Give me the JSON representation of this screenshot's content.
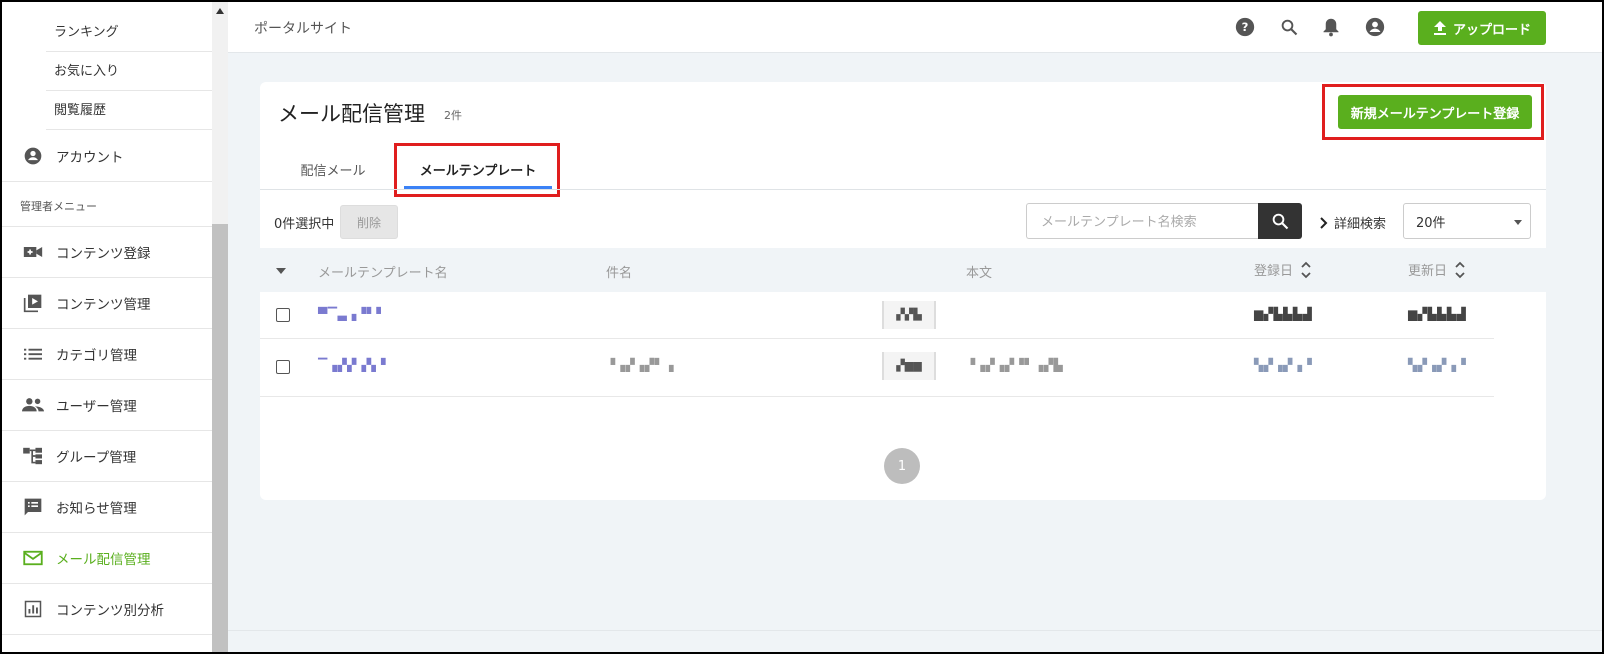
{
  "sidebar": {
    "sub_items": [
      "ランキング",
      "お気に入り",
      "閲覧履歴"
    ],
    "account_label": "アカウント",
    "admin_section_label": "管理者メニュー",
    "admin_items": [
      {
        "label": "コンテンツ登録",
        "icon": "video-add-icon"
      },
      {
        "label": "コンテンツ管理",
        "icon": "play-library-icon"
      },
      {
        "label": "カテゴリ管理",
        "icon": "list-icon"
      },
      {
        "label": "ユーザー管理",
        "icon": "people-icon"
      },
      {
        "label": "グループ管理",
        "icon": "tree-icon"
      },
      {
        "label": "お知らせ管理",
        "icon": "announcement-icon"
      },
      {
        "label": "メール配信管理",
        "icon": "mail-icon",
        "active": true
      },
      {
        "label": "コンテンツ別分析",
        "icon": "analytics-icon"
      }
    ]
  },
  "header": {
    "site_title": "ポータルサイト",
    "icons": [
      "help-icon",
      "search-icon",
      "bell-icon",
      "account-icon"
    ],
    "upload_label": "アップロード"
  },
  "main": {
    "title": "メール配信管理",
    "count": "2件",
    "new_button_label": "新規メールテンプレート登録",
    "tabs": [
      {
        "label": "配信メール",
        "active": false
      },
      {
        "label": "メールテンプレート",
        "active": true
      }
    ],
    "selected_count": "0件選択中",
    "delete_label": "削除",
    "search_placeholder": "メールテンプレート名検索",
    "advanced_search_label": "詳細検索",
    "per_page": "20件",
    "columns": [
      "メールテンプレート名",
      "件名",
      "本文",
      "登録日",
      "更新日"
    ],
    "rows": [
      {
        "name": "▀▔▃▗▝▘▘",
        "subject": "",
        "thumb": "▞▞▙",
        "body": "",
        "created": "▆▞▙▙▙▟",
        "updated": "▆▞▙▙▙▟"
      },
      {
        "name": "▔▗▞▞▗▚▝",
        "subject": "▝▗▞▗▞▘▗",
        "thumb": "▞▆▆",
        "body": "▝▗▞▗▞▝▘▗▞▙",
        "created": "▚▞▗▞▗▝",
        "updated": "▚▞▗▞▗▝"
      }
    ],
    "current_page": "1"
  },
  "colors": {
    "accent": "#5aaf1e",
    "highlight": "#e01e1e",
    "tab_underline": "#3b82f6"
  }
}
